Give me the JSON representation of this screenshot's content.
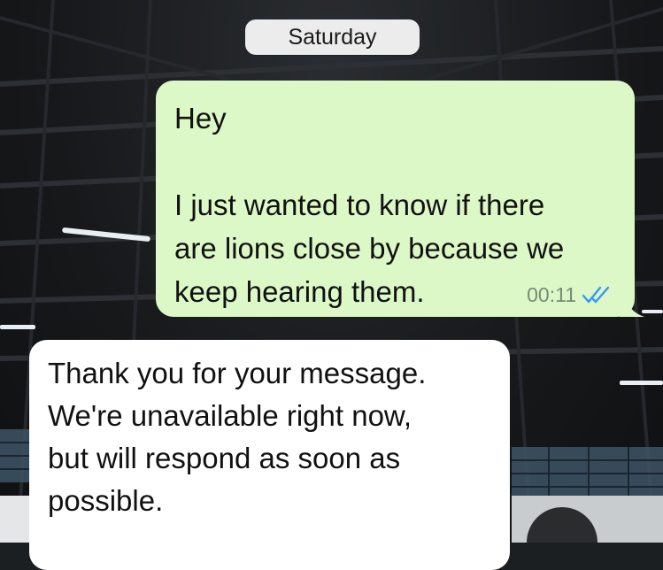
{
  "chat": {
    "date_separator": "Saturday",
    "messages": [
      {
        "direction": "outgoing",
        "lines": [
          "Hey",
          "",
          "I just wanted to know if there",
          "are lions close by because we",
          "keep hearing them."
        ],
        "time": "00:11",
        "status": "read",
        "status_icon": "double-check-icon",
        "status_color": "#3497f9",
        "bubble_color": "#dcf8c6"
      },
      {
        "direction": "incoming",
        "lines": [
          "Thank you for your message.",
          "We're unavailable right now,",
          "but will respond as soon as",
          "possible."
        ],
        "bubble_color": "#ffffff"
      }
    ]
  }
}
